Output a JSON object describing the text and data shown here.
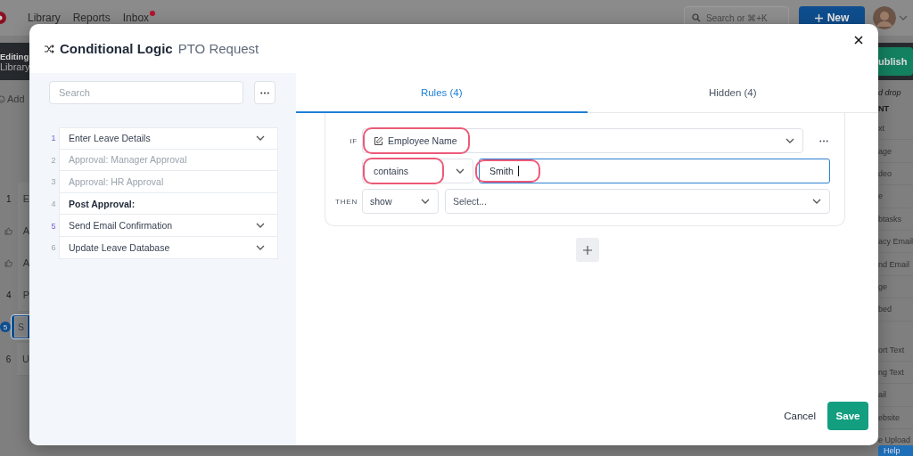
{
  "background": {
    "nav": [
      {
        "label": "Library",
        "unread": false
      },
      {
        "label": "Reports",
        "unread": false
      },
      {
        "label": "Inbox",
        "unread": true
      }
    ],
    "search": {
      "placeholder": "Search or ⌘+K"
    },
    "new_button": "New",
    "editing": {
      "title": "Editing",
      "subtitle": "Library"
    },
    "add": "Add",
    "steps": [
      {
        "kind": "number",
        "number": "1",
        "label": "E",
        "selected": false
      },
      {
        "kind": "approval",
        "label": "A",
        "selected": false
      },
      {
        "kind": "approval",
        "label": "A",
        "selected": false
      },
      {
        "kind": "number",
        "number": "4",
        "label": "P",
        "selected": false
      },
      {
        "kind": "number",
        "number": "5",
        "label": "S",
        "selected": true
      },
      {
        "kind": "number",
        "number": "6",
        "label": "U",
        "selected": false
      }
    ],
    "publish": "ublish",
    "palette": {
      "hint": "d drop",
      "heading": "NT",
      "items": [
        "xt",
        "age",
        "deo",
        "e",
        "btasks",
        "acy Email",
        "nd Email",
        "ge",
        "bed"
      ],
      "items_2": [
        "ort Text",
        "ng Text",
        "ail",
        "ebsite",
        "e Upload"
      ]
    },
    "help": "Help"
  },
  "dialog": {
    "title": "Conditional Logic",
    "subtitle": "PTO Request",
    "search": {
      "placeholder": "Search"
    },
    "steps": [
      {
        "number": "1",
        "label": "Enter Leave Details",
        "kind": "step",
        "active": true,
        "disabled": false,
        "expandable": true
      },
      {
        "number": "2",
        "label": "Approval: Manager Approval",
        "kind": "step",
        "active": false,
        "disabled": true,
        "expandable": false
      },
      {
        "number": "3",
        "label": "Approval: HR Approval",
        "kind": "step",
        "active": false,
        "disabled": true,
        "expandable": false
      },
      {
        "number": "4",
        "label": "Post Approval:",
        "kind": "section",
        "active": false,
        "disabled": false,
        "expandable": false
      },
      {
        "number": "5",
        "label": "Send Email Confirmation",
        "kind": "step",
        "active": true,
        "disabled": false,
        "expandable": true
      },
      {
        "number": "6",
        "label": "Update Leave Database",
        "kind": "step",
        "active": false,
        "disabled": false,
        "expandable": true
      }
    ],
    "tabs": [
      {
        "label": "Rules (4)",
        "selected": true
      },
      {
        "label": "Hidden (4)",
        "selected": false
      }
    ],
    "rule": {
      "if_label": "IF",
      "field": {
        "text": "Employee Name",
        "highlighted": true
      },
      "operator": {
        "text": "contains",
        "highlighted": true
      },
      "value": {
        "text": "Smith",
        "highlighted": true,
        "focused": true
      },
      "then_label": "THEN",
      "action": {
        "text": "show"
      },
      "target": {
        "text": "Select..."
      }
    },
    "cancel": "Cancel",
    "save": "Save"
  }
}
